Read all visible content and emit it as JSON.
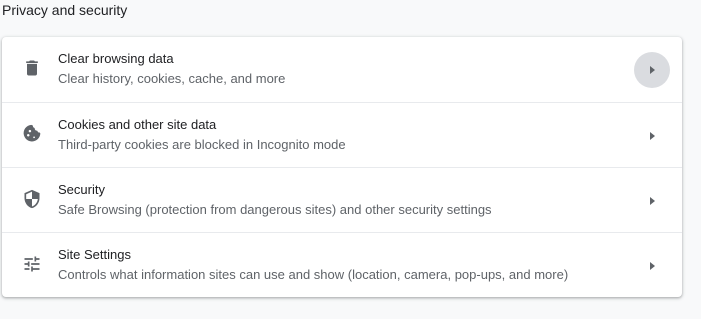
{
  "section": {
    "title": "Privacy and security"
  },
  "rows": [
    {
      "label": "Clear browsing data",
      "sublabel": "Clear history, cookies, cache, and more",
      "icon": "trash-icon",
      "arrow_hovered": true
    },
    {
      "label": "Cookies and other site data",
      "sublabel": "Third-party cookies are blocked in Incognito mode",
      "icon": "cookie-icon",
      "arrow_hovered": false
    },
    {
      "label": "Security",
      "sublabel": "Safe Browsing (protection from dangerous sites) and other security settings",
      "icon": "shield-icon",
      "arrow_hovered": false
    },
    {
      "label": "Site Settings",
      "sublabel": "Controls what information sites can use and show (location, camera, pop-ups, and more)",
      "icon": "tune-icon",
      "arrow_hovered": false
    }
  ],
  "colors": {
    "page_bg": "#f8f9fa",
    "card_bg": "#ffffff",
    "primary_text": "#202124",
    "secondary_text": "#5f6368",
    "hover_circle": "#dadce0"
  }
}
